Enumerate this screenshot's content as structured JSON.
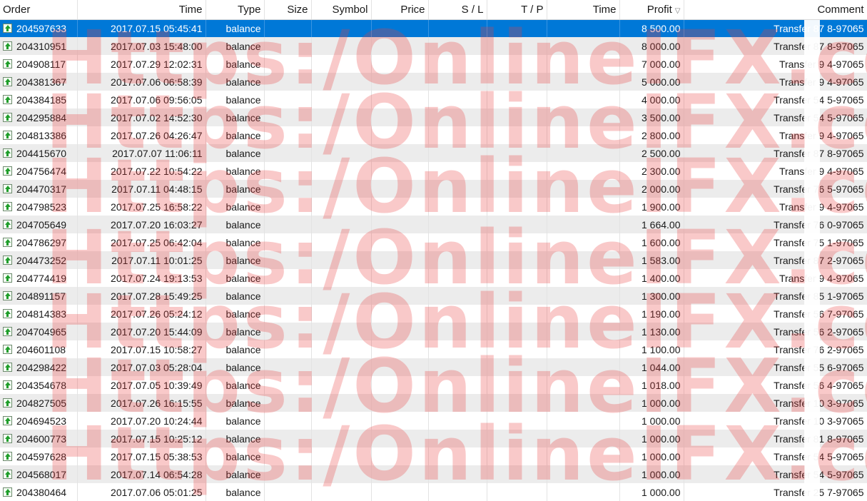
{
  "columns": [
    {
      "key": "order",
      "label": "Order",
      "align": "left",
      "width": 108
    },
    {
      "key": "time",
      "label": "Time",
      "align": "right",
      "width": 180
    },
    {
      "key": "type",
      "label": "Type",
      "align": "right",
      "width": 82
    },
    {
      "key": "size",
      "label": "Size",
      "align": "right",
      "width": 66
    },
    {
      "key": "symbol",
      "label": "Symbol",
      "align": "right",
      "width": 84
    },
    {
      "key": "price",
      "label": "Price",
      "align": "right",
      "width": 80
    },
    {
      "key": "sl",
      "label": "S / L",
      "align": "right",
      "width": 82
    },
    {
      "key": "tp",
      "label": "T / P",
      "align": "right",
      "width": 84
    },
    {
      "key": "time2",
      "label": "Time",
      "align": "right",
      "width": 102
    },
    {
      "key": "profit",
      "label": "Profit",
      "align": "right",
      "width": 90
    },
    {
      "key": "comment",
      "label": "Comment",
      "align": "right",
      "width": 257
    }
  ],
  "sort_indicator": "▽",
  "watermark": "Https:/OnlineIFX.com",
  "rows": [
    {
      "order": "204597633",
      "time": "2017.07.15 05:45:41",
      "type": "balance",
      "profit": "8 500.00",
      "comment": "Transfer 87     8-97065",
      "selected": true
    },
    {
      "order": "204310951",
      "time": "2017.07.03 15:48:00",
      "type": "balance",
      "profit": "8 000.00",
      "comment": "Transfer 87     8-97065"
    },
    {
      "order": "204908117",
      "time": "2017.07.29 12:02:31",
      "type": "balance",
      "profit": "7 000.00",
      "comment": "Transfer 9     4-97065"
    },
    {
      "order": "204381367",
      "time": "2017.07.06 06:58:39",
      "type": "balance",
      "profit": "5 000.00",
      "comment": "Transfer 9     4-97065"
    },
    {
      "order": "204384185",
      "time": "2017.07.06 09:56:05",
      "type": "balance",
      "profit": "4 000.00",
      "comment": "Transfer 54     5-97065"
    },
    {
      "order": "204295884",
      "time": "2017.07.02 14:52:30",
      "type": "balance",
      "profit": "3 500.00",
      "comment": "Transfer 54     5-97065"
    },
    {
      "order": "204813386",
      "time": "2017.07.26 04:26:47",
      "type": "balance",
      "profit": "2 800.00",
      "comment": "Transfer 9     4-97065"
    },
    {
      "order": "204415670",
      "time": "2017.07.07 11:06:11",
      "type": "balance",
      "profit": "2 500.00",
      "comment": "Transfer 87     8-97065"
    },
    {
      "order": "204756474",
      "time": "2017.07.22 10:54:22",
      "type": "balance",
      "profit": "2 300.00",
      "comment": "Transfer 9     4-97065"
    },
    {
      "order": "204470317",
      "time": "2017.07.11 04:48:15",
      "type": "balance",
      "profit": "2 000.00",
      "comment": "Transfer 76     5-97065"
    },
    {
      "order": "204798523",
      "time": "2017.07.25 16:58:22",
      "type": "balance",
      "profit": "1 900.00",
      "comment": "Transfer 9     4-97065"
    },
    {
      "order": "204705649",
      "time": "2017.07.20 16:03:27",
      "type": "balance",
      "profit": "1 664.00",
      "comment": "Transfer 76     0-97065"
    },
    {
      "order": "204786297",
      "time": "2017.07.25 06:42:04",
      "type": "balance",
      "profit": "1 600.00",
      "comment": "Transfer 75     1-97065"
    },
    {
      "order": "204473252",
      "time": "2017.07.11 10:01:25",
      "type": "balance",
      "profit": "1 583.00",
      "comment": "Transfer 87     2-97065"
    },
    {
      "order": "204774419",
      "time": "2017.07.24 19:13:53",
      "type": "balance",
      "profit": "1 400.00",
      "comment": "Transfer 9     4-97065"
    },
    {
      "order": "204891157",
      "time": "2017.07.28 15:49:25",
      "type": "balance",
      "profit": "1 300.00",
      "comment": "Transfer 85     1-97065"
    },
    {
      "order": "204814383",
      "time": "2017.07.26 05:24:12",
      "type": "balance",
      "profit": "1 190.00",
      "comment": "Transfer 56     7-97065"
    },
    {
      "order": "204704965",
      "time": "2017.07.20 15:44:09",
      "type": "balance",
      "profit": "1 130.00",
      "comment": "Transfer 56     2-97065"
    },
    {
      "order": "204601108",
      "time": "2017.07.15 10:58:27",
      "type": "balance",
      "profit": "1 100.00",
      "comment": "Transfer 76     2-97065"
    },
    {
      "order": "204298422",
      "time": "2017.07.03 05:28:04",
      "type": "balance",
      "profit": "1 044.00",
      "comment": "Transfer 55     6-97065"
    },
    {
      "order": "204354678",
      "time": "2017.07.05 10:39:49",
      "type": "balance",
      "profit": "1 018.00",
      "comment": "Transfer 56     4-97065"
    },
    {
      "order": "204827505",
      "time": "2017.07.26 16:15:55",
      "type": "balance",
      "profit": "1 000.00",
      "comment": "Transfer 10     3-97065"
    },
    {
      "order": "204694523",
      "time": "2017.07.20 10:24:44",
      "type": "balance",
      "profit": "1 000.00",
      "comment": "Transfer 10     3-97065"
    },
    {
      "order": "204600773",
      "time": "2017.07.15 10:25:12",
      "type": "balance",
      "profit": "1 000.00",
      "comment": "Transfer 81     8-97065"
    },
    {
      "order": "204597628",
      "time": "2017.07.15 05:38:53",
      "type": "balance",
      "profit": "1 000.00",
      "comment": "Transfer 54     5-97065"
    },
    {
      "order": "204568017",
      "time": "2017.07.14 06:54:28",
      "type": "balance",
      "profit": "1 000.00",
      "comment": "Transfer 54     5-97065"
    },
    {
      "order": "204380464",
      "time": "2017.07.06 05:01:25",
      "type": "balance",
      "profit": "1 000.00",
      "comment": "Transfer 25     7-97065"
    }
  ]
}
